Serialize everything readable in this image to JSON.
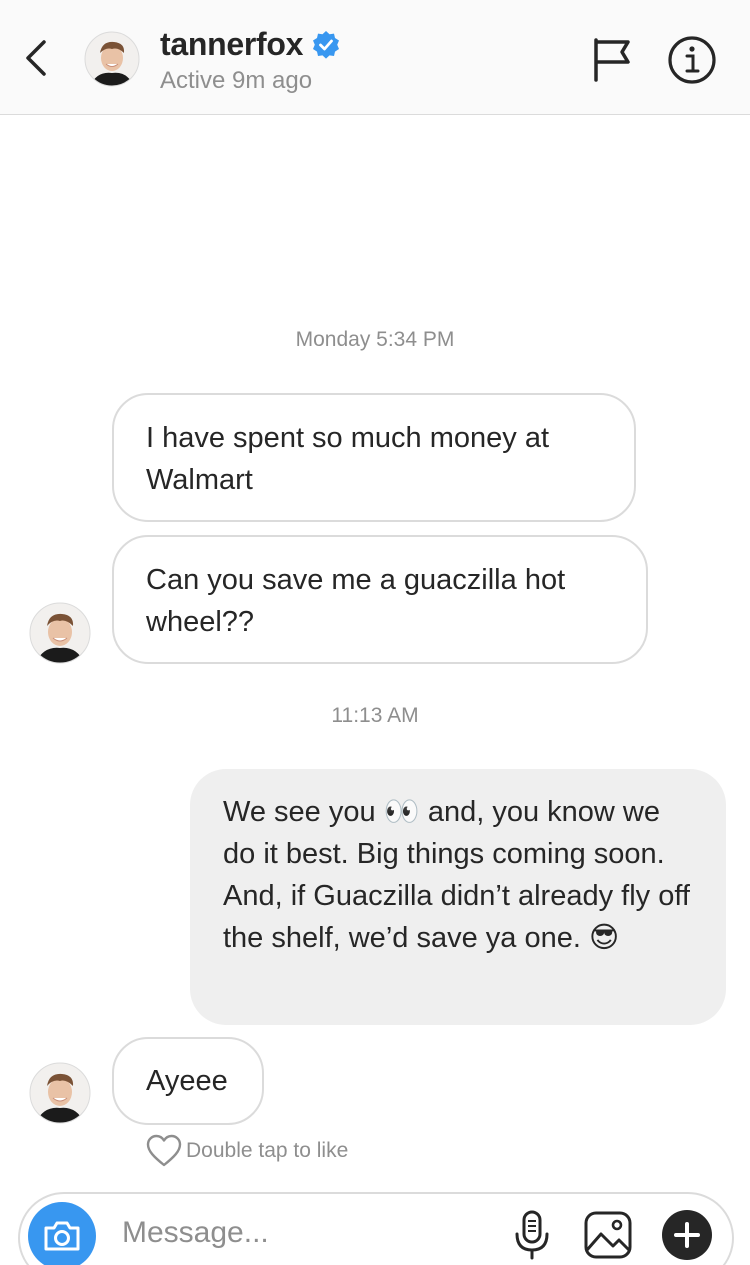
{
  "header": {
    "username": "tannerfox",
    "status": "Active 9m ago"
  },
  "thread": {
    "timestamp_1": "Monday 5:34 PM",
    "msg_1": "I have spent so much money at Walmart",
    "msg_2": "Can you save me a guaczilla hot wheel??",
    "timestamp_2": "11:13 AM",
    "reply": "We see you 👀 and, you know we do it best. Big things coming soon. And, if Guaczilla didn’t already fly off the shelf, we’d save ya one. 😎",
    "msg_3": "Ayeee",
    "like_hint": "Double tap to like"
  },
  "composer": {
    "placeholder": "Message..."
  },
  "colors": {
    "accent": "#3897f0",
    "outgoing_bubble": "#efefef",
    "border": "#dbdbdb",
    "muted_text": "#8e8e8e"
  },
  "icons": [
    "back-chevron-icon",
    "verified-badge-icon",
    "flag-icon",
    "info-icon",
    "heart-icon",
    "camera-icon",
    "microphone-icon",
    "gallery-icon",
    "plus-icon"
  ]
}
